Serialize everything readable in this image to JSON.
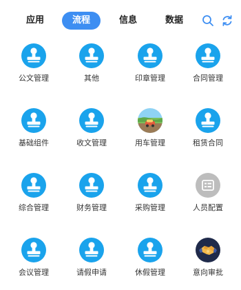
{
  "tabs": [
    {
      "label": "应用",
      "active": false
    },
    {
      "label": "流程",
      "active": true
    },
    {
      "label": "信息",
      "active": false
    },
    {
      "label": "数据",
      "active": false
    }
  ],
  "toolbar": {
    "search_icon": "search-icon",
    "refresh_icon": "refresh-icon"
  },
  "colors": {
    "accent": "#3d8ef2",
    "icon_blue": "#1aa3ec",
    "icon_gray": "#bdbdbd"
  },
  "apps": [
    {
      "label": "公文管理",
      "icon": "stamp-icon"
    },
    {
      "label": "其他",
      "icon": "stamp-icon"
    },
    {
      "label": "印章管理",
      "icon": "stamp-icon"
    },
    {
      "label": "合同管理",
      "icon": "stamp-icon"
    },
    {
      "label": "基础组件",
      "icon": "stamp-icon"
    },
    {
      "label": "收文管理",
      "icon": "stamp-icon"
    },
    {
      "label": "用车管理",
      "icon": "car-landscape-icon"
    },
    {
      "label": "租赁合同",
      "icon": "stamp-icon"
    },
    {
      "label": "综合管理",
      "icon": "stamp-icon"
    },
    {
      "label": "财务管理",
      "icon": "stamp-icon"
    },
    {
      "label": "采购管理",
      "icon": "stamp-icon"
    },
    {
      "label": "人员配置",
      "icon": "personnel-config-icon"
    },
    {
      "label": "会议管理",
      "icon": "stamp-icon"
    },
    {
      "label": "请假申请",
      "icon": "stamp-icon"
    },
    {
      "label": "休假管理",
      "icon": "stamp-icon"
    },
    {
      "label": "意向审批",
      "icon": "handshake-icon"
    }
  ]
}
